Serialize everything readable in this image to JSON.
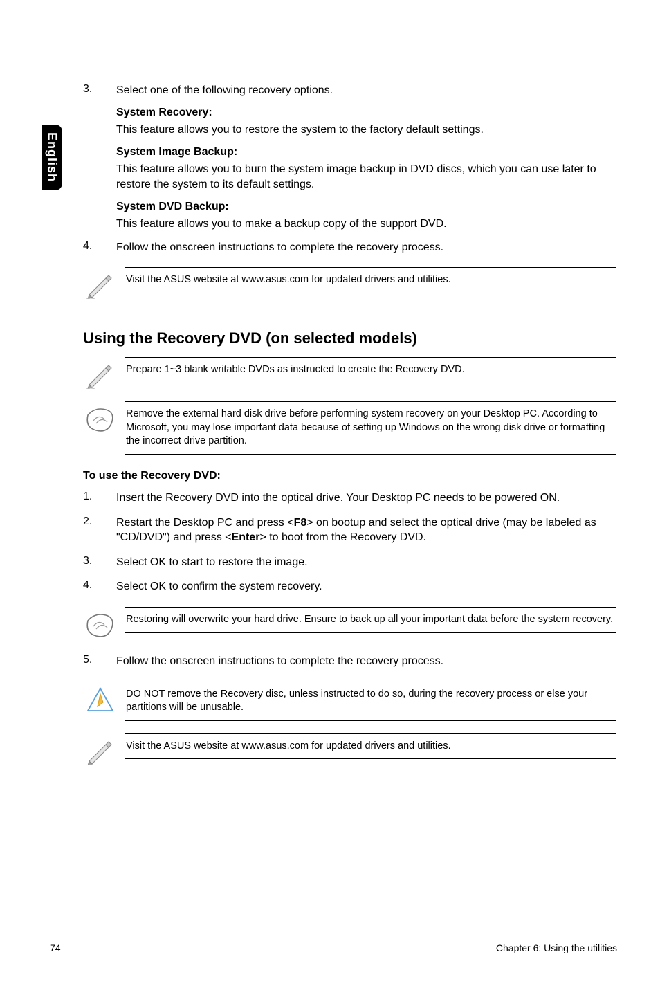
{
  "sideTab": "English",
  "block1": {
    "items": [
      {
        "num": "3.",
        "lead": "Select one of the following recovery options.",
        "sections": [
          {
            "heading": "System Recovery:",
            "text": "This feature allows you to restore the system to the factory default settings."
          },
          {
            "heading": "System Image Backup:",
            "text": "This feature allows you to burn the system image backup in DVD discs, which you can use later to restore the system to its default settings."
          },
          {
            "heading": "System DVD Backup:",
            "text": "This feature allows you to make a backup copy of the support DVD."
          }
        ]
      },
      {
        "num": "4.",
        "lead": "Follow the onscreen instructions to complete the recovery process."
      }
    ]
  },
  "callout1": "Visit the ASUS website at www.asus.com for updated drivers and utilities.",
  "sectionTitle": "Using the Recovery DVD (on selected models)",
  "callout2": "Prepare 1~3 blank writable DVDs as instructed to create the Recovery DVD.",
  "callout3": "Remove the external hard disk drive before performing system recovery on your Desktop PC. According to Microsoft, you may lose important data because of setting up Windows on the wrong disk drive or formatting the incorrect drive partition.",
  "paraHeading": "To use the Recovery DVD:",
  "block2": {
    "items": [
      {
        "num": "1.",
        "text": "Insert the Recovery DVD into the optical drive. Your Desktop PC needs to be powered ON."
      },
      {
        "num": "2.",
        "textParts": [
          "Restart the Desktop PC and press <",
          "F8",
          "> on bootup and select the optical drive (may be labeled as \"CD/DVD\") and press <",
          "Enter",
          "> to boot from the Recovery DVD."
        ]
      },
      {
        "num": "3.",
        "text": "Select OK to start to restore the image."
      },
      {
        "num": "4.",
        "text": "Select OK to confirm the system recovery."
      }
    ]
  },
  "callout4": "Restoring will overwrite your hard drive. Ensure to back up all your important data before the system recovery.",
  "block3": {
    "items": [
      {
        "num": "5.",
        "text": "Follow the onscreen instructions to complete the recovery process."
      }
    ]
  },
  "callout5": "DO NOT remove the Recovery disc, unless instructed to do so, during the recovery process or else your partitions will be unusable.",
  "callout6": "Visit the ASUS website at www.asus.com for updated drivers and utilities.",
  "footer": {
    "page": "74",
    "chapter": "Chapter 6: Using the utilities"
  }
}
